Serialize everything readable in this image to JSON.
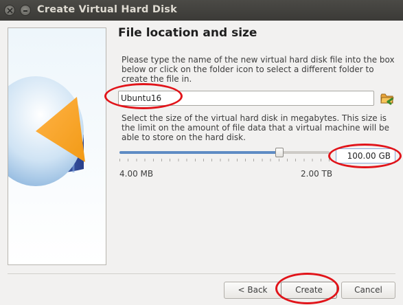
{
  "window": {
    "title": "Create Virtual Hard Disk"
  },
  "page": {
    "heading": "File location and size",
    "location_desc": "Please type the name of the new virtual hard disk file into the box below or click on the folder icon to select a different folder to create the file in.",
    "size_desc": "Select the size of the virtual hard disk in megabytes. This size is the limit on the amount of file data that a virtual machine will be able to store on the hard disk."
  },
  "file_location": {
    "value": "Ubuntu16",
    "folder_icon": "folder-icon"
  },
  "size": {
    "value": "100.00 GB",
    "min_label": "4.00 MB",
    "max_label": "2.00 TB",
    "slider_fraction": 0.76
  },
  "buttons": {
    "back": "< Back",
    "create": "Create",
    "cancel": "Cancel"
  },
  "annotation_color": "#e1141a"
}
